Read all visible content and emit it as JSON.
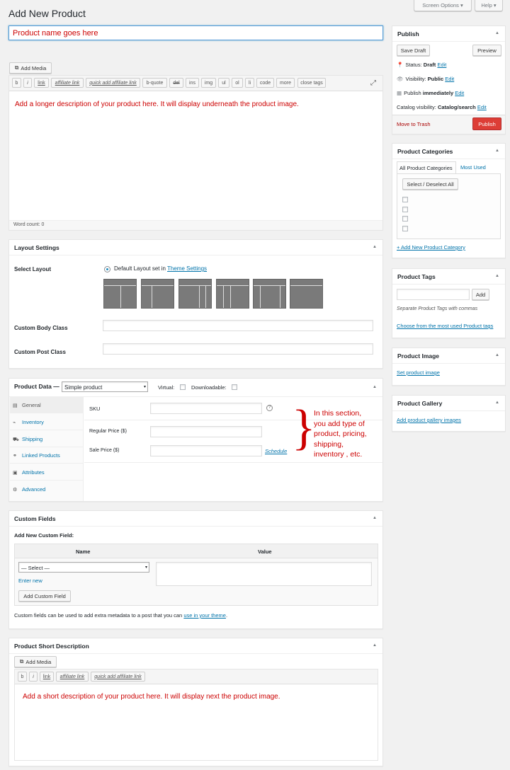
{
  "page": {
    "title": "Add New Product"
  },
  "top_buttons": {
    "screen_options": "Screen Options ▾",
    "help": "Help ▾"
  },
  "title_field": {
    "value": "Product name goes here"
  },
  "editor": {
    "add_media": "Add Media",
    "quicktags": [
      "b",
      "i",
      "link",
      "affiliate link",
      "quick add affiliate link",
      "b-quote",
      "del",
      "ins",
      "img",
      "ul",
      "ol",
      "li",
      "code",
      "more",
      "close tags"
    ],
    "content": "Add a longer description of your product here. It will display underneath the product image.",
    "word_count": "Word count: 0"
  },
  "layout_settings": {
    "title": "Layout Settings",
    "select_layout": "Select Layout",
    "default_layout": "Default Layout set in",
    "theme_settings_link": "Theme Settings",
    "custom_body_class": "Custom Body Class",
    "custom_post_class": "Custom Post Class"
  },
  "product_data": {
    "title": "Product Data —",
    "type": "Simple product",
    "virtual": "Virtual:",
    "downloadable": "Downloadable:",
    "tabs": [
      "General",
      "Inventory",
      "Shipping",
      "Linked Products",
      "Attributes",
      "Advanced"
    ],
    "tab_icons": [
      "general-icon",
      "inventory-icon",
      "shipping-icon",
      "linked-products-icon",
      "attributes-icon",
      "advanced-icon"
    ],
    "sku": "SKU",
    "regular_price": "Regular Price ($)",
    "sale_price": "Sale Price ($)",
    "schedule": "Schedule",
    "annotation": [
      "In this section,",
      "you add type of",
      "product, pricing,",
      "shipping,",
      "inventory , etc."
    ]
  },
  "custom_fields": {
    "title": "Custom Fields",
    "add_new": "Add New Custom Field:",
    "col_name": "Name",
    "col_value": "Value",
    "select": "— Select —",
    "enter_new": "Enter new",
    "add_button": "Add Custom Field",
    "note": "Custom fields can be used to add extra metadata to a post that you can",
    "note_link": "use in your theme",
    "note_end": "."
  },
  "short_description": {
    "title": "Product Short Description",
    "add_media": "Add Media",
    "quicktags": [
      "b",
      "i",
      "link",
      "affiliate link",
      "quick add affiliate link"
    ],
    "content": "Add a short description of your product here. It will display next the product image."
  },
  "publish": {
    "title": "Publish",
    "save_draft": "Save Draft",
    "preview": "Preview",
    "status_label": "Status:",
    "status_value": "Draft",
    "edit": "Edit",
    "visibility_label": "Visibility:",
    "visibility_value": "Public",
    "publish_label": "Publish",
    "publish_value": "immediately",
    "catalog_label": "Catalog visibility:",
    "catalog_value": "Catalog/search",
    "trash": "Move to Trash",
    "publish_button": "Publish"
  },
  "categories": {
    "title": "Product Categories",
    "tab_all": "All Product Categories",
    "tab_most": "Most Used",
    "select_all": "Select / Deselect All",
    "add_new": "+ Add New Product Category"
  },
  "tags": {
    "title": "Product Tags",
    "add": "Add",
    "hint": "Separate Product Tags with commas",
    "choose": "Choose from the most used Product tags"
  },
  "product_image": {
    "title": "Product Image",
    "link": "Set product image"
  },
  "gallery": {
    "title": "Product Gallery",
    "link": "Add product gallery images"
  },
  "colors": {
    "annotation": "#cc0000",
    "publish_button": "#dd3d36",
    "link": "#0073aa"
  }
}
